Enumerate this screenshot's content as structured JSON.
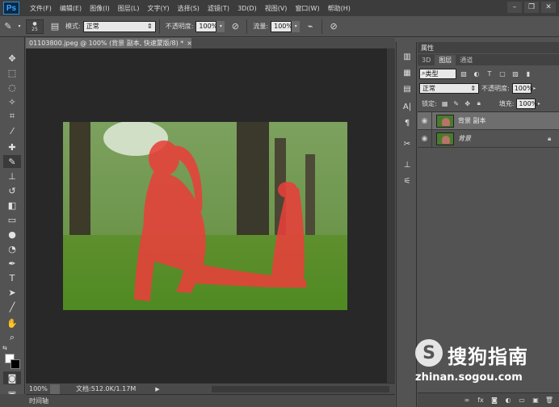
{
  "app": {
    "logo": "Ps"
  },
  "menu": [
    "文件(F)",
    "编辑(E)",
    "图像(I)",
    "图层(L)",
    "文字(Y)",
    "选择(S)",
    "滤镜(T)",
    "3D(D)",
    "视图(V)",
    "窗口(W)",
    "帮助(H)"
  ],
  "window_controls": {
    "minimize": "–",
    "restore": "❐",
    "close": "✕"
  },
  "options": {
    "brush_size": "25",
    "mode_label": "模式:",
    "mode_value": "正常",
    "opacity_label": "不透明度:",
    "opacity_value": "100%",
    "flow_label": "流量:",
    "flow_value": "100%"
  },
  "document": {
    "tab_title": "01103800.jpeg @ 100% (背景 副本, 快速蒙版/8) *",
    "tab_close": "×"
  },
  "status": {
    "zoom": "100%",
    "doc_info": "文档:512.0K/1.17M",
    "play": "▶"
  },
  "timeline": {
    "label": "时间轴"
  },
  "panels": {
    "properties_tab": "属性",
    "tabs": [
      "3D",
      "图层",
      "通道"
    ],
    "filter_type": "类型",
    "blend_mode": "正常",
    "opacity_label": "不透明度:",
    "opacity_value": "100%",
    "lock_label": "锁定:",
    "fill_label": "填充:",
    "fill_value": "100%"
  },
  "layers": [
    {
      "name": "背景 副本",
      "selected": true,
      "locked": false
    },
    {
      "name": "背景",
      "selected": false,
      "locked": true
    }
  ],
  "watermark": {
    "glyph": "S",
    "brand": "搜狗指南",
    "url": "zhinan.sogou.com"
  },
  "colors": {
    "foreground": "#ffffff",
    "background": "#000000",
    "quick_mask_overlay": "#e8403a"
  }
}
